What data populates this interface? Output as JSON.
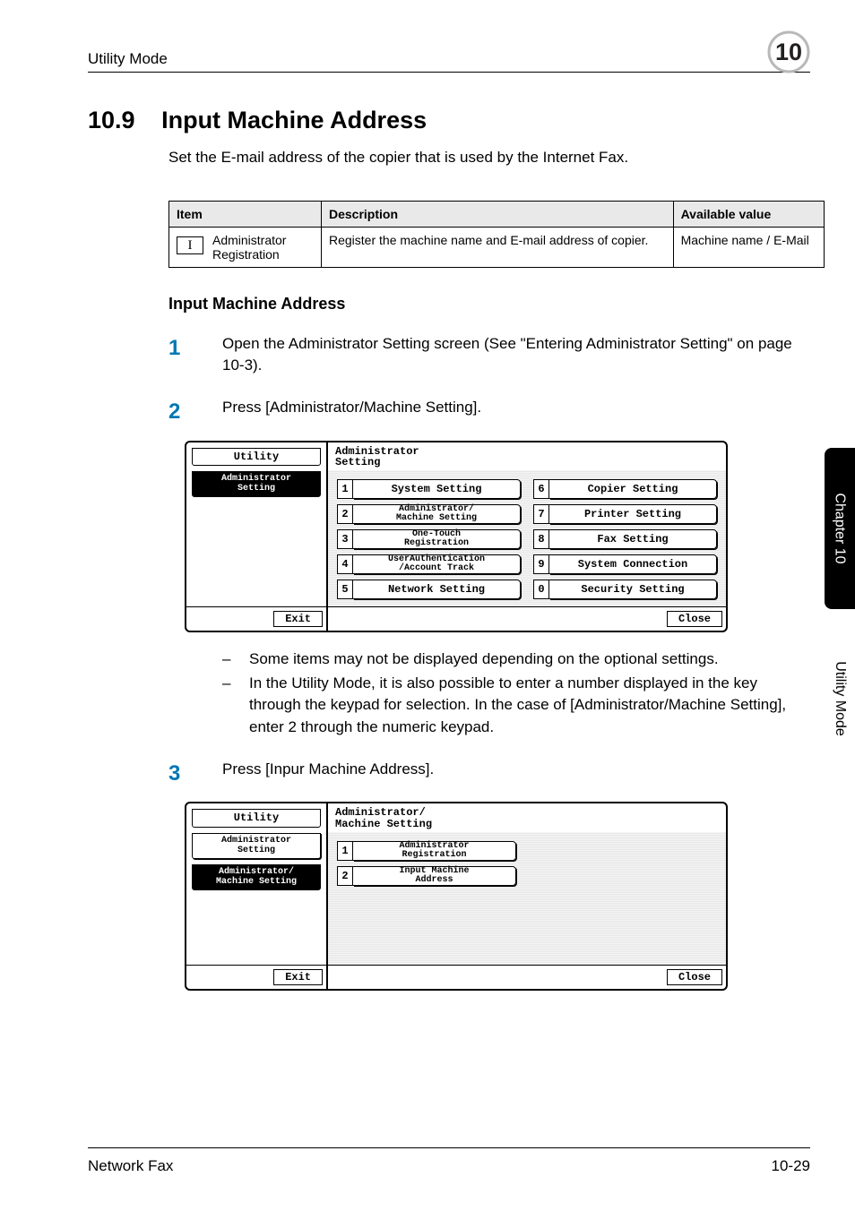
{
  "header": {
    "left": "Utility Mode",
    "chapter_num": "10"
  },
  "sideTabs": {
    "dark": "Chapter 10",
    "light": "Utility Mode"
  },
  "section": {
    "number": "10.9",
    "title": "Input Machine Address"
  },
  "intro": "Set the E-mail address of the copier that is used by the Internet Fax.",
  "table": {
    "headers": [
      "Item",
      "Description",
      "Available value"
    ],
    "row": {
      "roman": "I",
      "item": "Administrator Registration",
      "desc": "Register the machine name and E-mail address of copier.",
      "avail": "Machine name / E-Mail"
    }
  },
  "subhead": "Input Machine Address",
  "steps": {
    "s1": {
      "num": "1",
      "text": "Open the Administrator Setting screen (See \"Entering Administrator Setting\" on page 10-3)."
    },
    "s2": {
      "num": "2",
      "text": "Press [Administrator/Machine Setting]."
    },
    "s3": {
      "num": "3",
      "text": "Press [Inpur Machine Address]."
    }
  },
  "notes": {
    "n1": "Some items may not be displayed depending on the optional settings.",
    "n2": "In the Utility Mode, it is also possible to enter a number displayed in the key through the keypad for selection. In the case of [Administrator/Machine Setting], enter 2 through the numeric keypad."
  },
  "screen1": {
    "leftTitle": "Utility",
    "leftSel": "Administrator\nSetting",
    "rightTitle": "Administrator\nSetting",
    "exit": "Exit",
    "close": "Close",
    "left_buttons": [
      {
        "n": "1",
        "label": "System Setting",
        "two": false
      },
      {
        "n": "2",
        "label": "Administrator/\nMachine Setting",
        "two": true
      },
      {
        "n": "3",
        "label": "One-Touch\nRegistration",
        "two": true
      },
      {
        "n": "4",
        "label": "UserAuthentication\n/Account Track",
        "two": true
      },
      {
        "n": "5",
        "label": "Network Setting",
        "two": false
      }
    ],
    "right_buttons": [
      {
        "n": "6",
        "label": "Copier Setting",
        "two": false
      },
      {
        "n": "7",
        "label": "Printer Setting",
        "two": false
      },
      {
        "n": "8",
        "label": "Fax Setting",
        "two": false
      },
      {
        "n": "9",
        "label": "System Connection",
        "two": false
      },
      {
        "n": "0",
        "label": "Security Setting",
        "two": false
      }
    ]
  },
  "screen2": {
    "leftTitle": "Utility",
    "leftTab1": "Administrator\nSetting",
    "leftTab2": "Administrator/\nMachine Setting",
    "rightTitle": "Administrator/\nMachine Setting",
    "exit": "Exit",
    "close": "Close",
    "buttons": [
      {
        "n": "1",
        "label": "Administrator\nRegistration",
        "two": true
      },
      {
        "n": "2",
        "label": "Input Machine\nAddress",
        "two": true
      }
    ]
  },
  "footer": {
    "left": "Network Fax",
    "right": "10-29"
  }
}
